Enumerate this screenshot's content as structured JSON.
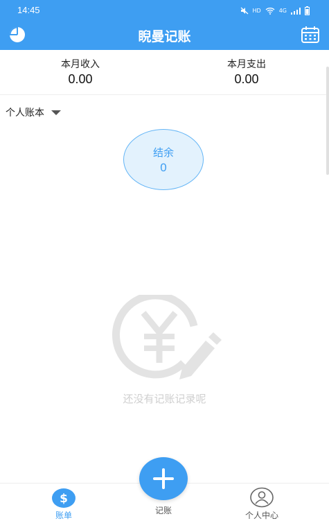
{
  "status": {
    "time": "14:45",
    "hd": "HD",
    "net": "4G"
  },
  "appbar": {
    "title": "睨曼记账",
    "left_icon": "pie-chart-icon",
    "right_icon": "calendar-icon"
  },
  "summary": {
    "income_label": "本月收入",
    "income_value": "0.00",
    "expense_label": "本月支出",
    "expense_value": "0.00"
  },
  "book": {
    "selected": "个人账本"
  },
  "balance": {
    "label": "结余",
    "value": "0"
  },
  "empty": {
    "message": "还没有记账记录呢",
    "icon": "yen-pencil-icon"
  },
  "tabs": [
    {
      "label": "账单",
      "icon": "dollar-icon",
      "active": true
    },
    {
      "label": "记账",
      "icon": "plus-icon",
      "active": false
    },
    {
      "label": "个人中心",
      "icon": "user-icon",
      "active": false
    }
  ],
  "colors": {
    "primary": "#3e9ef2",
    "balance_bg": "#e3f2fd",
    "empty_gray": "#cfcfcf"
  }
}
